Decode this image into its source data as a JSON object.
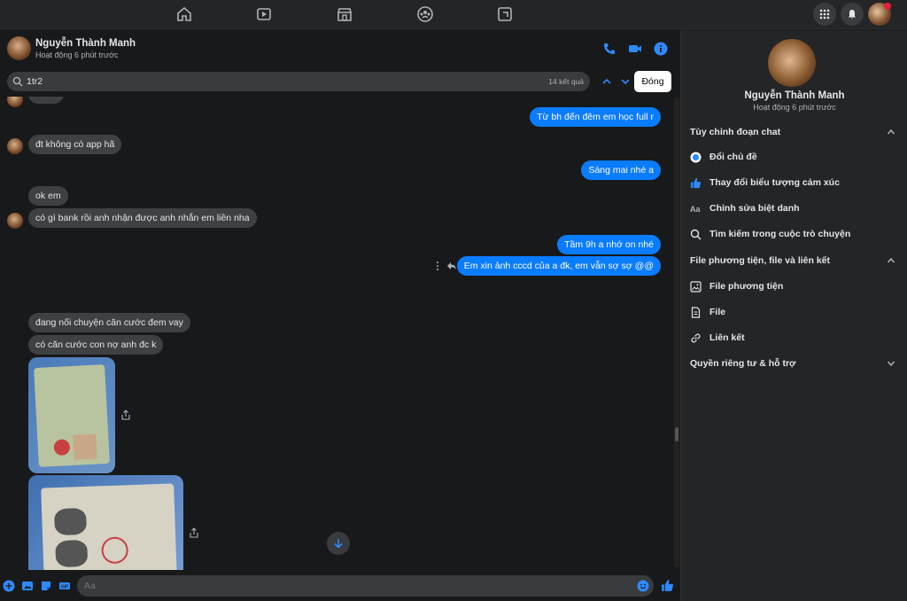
{
  "colors": {
    "accent": "#0a7cff",
    "bg": "#18191a",
    "panel": "#242526",
    "bubble_in": "#3e4042"
  },
  "topnav": {
    "icons": [
      "home-icon",
      "watch-icon",
      "marketplace-icon",
      "groups-icon",
      "gaming-icon"
    ],
    "right": [
      "menu-grid-icon",
      "bell-icon",
      "profile-avatar"
    ]
  },
  "header": {
    "name": "Nguyễn Thành Manh",
    "status": "Hoạt động 6 phút trước"
  },
  "search": {
    "value": "1tr2",
    "count": "14 kết quả",
    "close_label": "Đóng"
  },
  "messages": [
    {
      "dir": "out",
      "text": "Từ bh đến đêm em học full r"
    },
    {
      "dir": "in",
      "text": "đt không có app hã"
    },
    {
      "dir": "out",
      "text": "Sáng mai nhé a"
    },
    {
      "dir": "in",
      "text": "ok em"
    },
    {
      "dir": "in",
      "text": "có gì bank rồi anh nhận được anh nhắn em liền nha"
    },
    {
      "dir": "out",
      "text": "Tầm 9h a nhớ on nhé"
    },
    {
      "dir": "out",
      "text": "Em xin ảnh cccd của a đk, em vẫn sợ sợ @@"
    },
    {
      "dir": "in",
      "text": "đang nối chuyện căn cước đem vay"
    },
    {
      "dir": "in",
      "text": "có căn cước con nợ anh đc k"
    }
  ],
  "composer": {
    "placeholder": "Aa"
  },
  "panel": {
    "name": "Nguyễn Thành Manh",
    "status": "Hoạt động 6 phút trước",
    "sections": {
      "customize": "Tùy chỉnh đoạn chat",
      "media": "File phương tiện, file và liên kết",
      "privacy": "Quyền riêng tư & hỗ trợ"
    },
    "customize_items": [
      "Đổi chủ đề",
      "Thay đổi biểu tượng cảm xúc",
      "Chỉnh sửa biệt danh",
      "Tìm kiếm trong cuộc trò chuyện"
    ],
    "media_items": [
      "File phương tiện",
      "File",
      "Liên kết"
    ]
  }
}
